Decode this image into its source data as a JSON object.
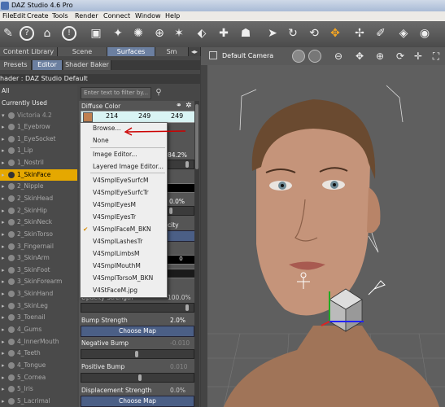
{
  "window": {
    "title": "DAZ Studio 4.6 Pro"
  },
  "menu": [
    "File",
    "Edit",
    "Create",
    "Tools",
    "Render",
    "Connect",
    "Window",
    "Help"
  ],
  "panel_tabs_top": [
    "Content Library",
    "Scene",
    "Surfaces",
    "Sm"
  ],
  "panel_tabs_sub": [
    "Presets",
    "Editor",
    "Shader Baker"
  ],
  "shader_line": "hader : DAZ Studio Default",
  "filter_placeholder": "Enter text to filter by...",
  "scene_list": {
    "all": "All",
    "currently_used": "Currently Used",
    "figure": "Victoria 4.2",
    "items": [
      "1_Eyebrow",
      "1_EyeSocket",
      "1_Lip",
      "1_Nostril",
      "1_SkinFace",
      "2_Nipple",
      "2_SkinHead",
      "2_SkinHip",
      "2_SkinNeck",
      "2_SkinTorso",
      "3_Fingernail",
      "3_SkinArm",
      "3_SkinFoot",
      "3_SkinForearm",
      "3_SkinHand",
      "3_SkinLeg",
      "3_Toenail",
      "4_Gums",
      "4_InnerMouth",
      "4_Teeth",
      "4_Tongue",
      "5_Cornea",
      "5_Iris",
      "5_Lacrimal"
    ],
    "selected": "1_SkinFace"
  },
  "properties": {
    "diffuse_color": {
      "label": "Diffuse Color",
      "r": "214",
      "g": "249",
      "b": "249"
    },
    "value_1": "84.2%",
    "value_2": "0.0%",
    "value_3": "0",
    "partial_label": "city",
    "opacity_strength": {
      "label": "Opacity Strength",
      "value": "100.0%"
    },
    "bump_strength": {
      "label": "Bump Strength",
      "value": "2.0%",
      "button": "Choose Map"
    },
    "negative_bump": {
      "label": "Negative Bump",
      "value": "-0.010"
    },
    "positive_bump": {
      "label": "Positive Bump",
      "value": "0.010"
    },
    "displacement_strength": {
      "label": "Displacement Strength",
      "value": "0.0%",
      "button": "Choose Map"
    }
  },
  "context_menu": {
    "items": [
      "Browse...",
      "None",
      "Image Editor...",
      "Layered Image Editor...",
      "V4SmplEyeSurfcM",
      "V4SmplEyeSurfcTr",
      "V4SmplEyesM",
      "V4SmplEyesTr",
      "V4SmplFaceM_BKN",
      "V4SmplLashesTr",
      "V4SmplLimbsM",
      "V4SmplMouthM",
      "V4SmplTorsoM_BKN",
      "V4StFaceM.jpg"
    ],
    "checked": "V4SmplFaceM_BKN"
  },
  "viewport": {
    "camera": "Default Camera"
  },
  "colors": {
    "selected_item": "#e5a800",
    "arrow": "#cc0000",
    "accent": "#f5a623"
  }
}
